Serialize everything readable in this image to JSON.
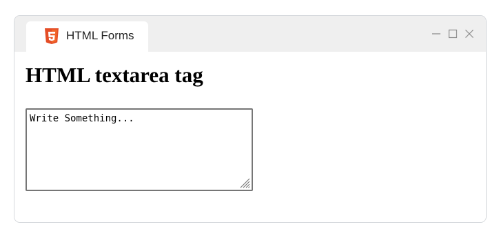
{
  "window": {
    "tab_title": "HTML Forms",
    "tab_icon": "html5-icon",
    "controls": {
      "minimize": "minimize-icon",
      "maximize": "maximize-icon",
      "close": "close-icon"
    }
  },
  "page": {
    "heading": "HTML textarea tag",
    "textarea": {
      "placeholder": "Write Something...",
      "value": ""
    }
  },
  "colors": {
    "html5_orange": "#e44d26",
    "titlebar": "#efefef",
    "textarea_border": "#767676"
  }
}
